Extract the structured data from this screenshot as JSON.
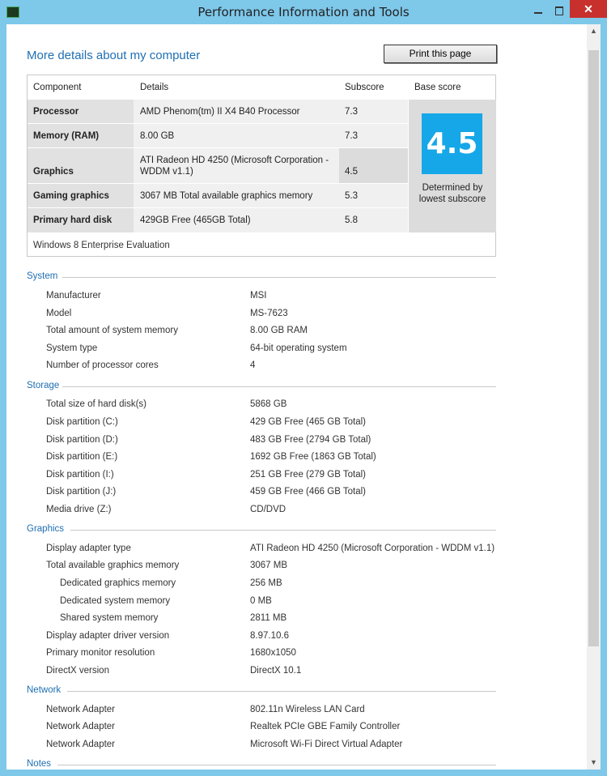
{
  "window": {
    "title": "Performance Information and Tools",
    "close_glyph": "✕"
  },
  "page": {
    "heading": "More details about my computer",
    "print_label": "Print this page"
  },
  "score_table": {
    "headers": [
      "Component",
      "Details",
      "Subscore",
      "Base score"
    ],
    "rows": [
      {
        "component": "Processor",
        "details": "AMD Phenom(tm) II X4 B40 Processor",
        "subscore": "7.3"
      },
      {
        "component": "Memory (RAM)",
        "details": "8.00 GB",
        "subscore": "7.3"
      },
      {
        "component": "Graphics",
        "details": "ATI Radeon HD 4250 (Microsoft Corporation - WDDM v1.1)",
        "subscore": "4.5"
      },
      {
        "component": "Gaming graphics",
        "details": "3067 MB Total available graphics memory",
        "subscore": "5.3"
      },
      {
        "component": "Primary hard disk",
        "details": "429GB Free (465GB Total)",
        "subscore": "5.8"
      }
    ],
    "base_score": "4.5",
    "base_note": "Determined by lowest subscore",
    "os": "Windows 8 Enterprise Evaluation"
  },
  "sections": {
    "system": {
      "title": "System",
      "items": [
        {
          "label": "Manufacturer",
          "value": "MSI"
        },
        {
          "label": "Model",
          "value": "MS-7623"
        },
        {
          "label": "Total amount of system memory",
          "value": "8.00 GB RAM"
        },
        {
          "label": "System type",
          "value": "64-bit operating system"
        },
        {
          "label": "Number of processor cores",
          "value": "4"
        }
      ]
    },
    "storage": {
      "title": "Storage",
      "items": [
        {
          "label": "Total size of hard disk(s)",
          "value": "5868 GB"
        },
        {
          "label": "Disk partition (C:)",
          "value": "429 GB Free (465 GB Total)"
        },
        {
          "label": "Disk partition (D:)",
          "value": "483 GB Free (2794 GB Total)"
        },
        {
          "label": "Disk partition (E:)",
          "value": "1692 GB Free (1863 GB Total)"
        },
        {
          "label": "Disk partition (I:)",
          "value": "251 GB Free (279 GB Total)"
        },
        {
          "label": "Disk partition (J:)",
          "value": "459 GB Free (466 GB Total)"
        },
        {
          "label": "Media drive (Z:)",
          "value": "CD/DVD"
        }
      ]
    },
    "graphics": {
      "title": "Graphics",
      "items": [
        {
          "label": "Display adapter type",
          "value": "ATI Radeon HD 4250 (Microsoft Corporation - WDDM v1.1)"
        },
        {
          "label": "Total available graphics memory",
          "value": "3067 MB"
        },
        {
          "label": "Dedicated graphics memory",
          "value": "256 MB"
        },
        {
          "label": "Dedicated system memory",
          "value": "0 MB"
        },
        {
          "label": "Shared system memory",
          "value": "2811 MB"
        },
        {
          "label": "Display adapter driver version",
          "value": "8.97.10.6"
        },
        {
          "label": "Primary monitor resolution",
          "value": "1680x1050"
        },
        {
          "label": "DirectX version",
          "value": "DirectX 10.1"
        }
      ]
    },
    "network": {
      "title": "Network",
      "items": [
        {
          "label": "Network Adapter",
          "value": "802.11n Wireless LAN Card"
        },
        {
          "label": "Network Adapter",
          "value": "Realtek PCIe GBE Family Controller"
        },
        {
          "label": "Network Adapter",
          "value": "Microsoft Wi-Fi Direct Virtual Adapter"
        }
      ]
    },
    "notes": {
      "title": "Notes"
    }
  },
  "scrollbar": {
    "up_glyph": "▲",
    "down_glyph": "▼"
  }
}
